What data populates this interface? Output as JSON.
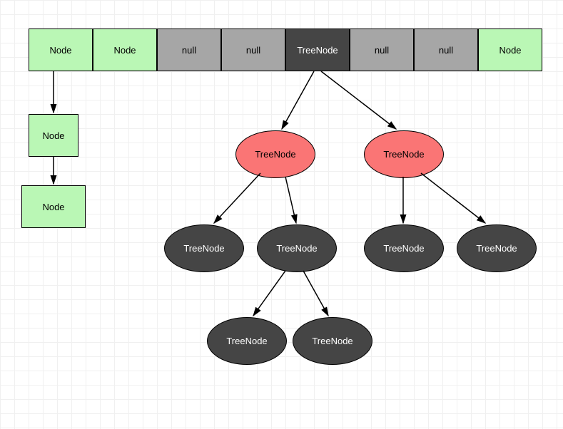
{
  "array": {
    "cells": [
      {
        "label": "Node",
        "type": "node"
      },
      {
        "label": "Node",
        "type": "node"
      },
      {
        "label": "null",
        "type": "null"
      },
      {
        "label": "null",
        "type": "null"
      },
      {
        "label": "TreeNode",
        "type": "tree-root"
      },
      {
        "label": "null",
        "type": "null"
      },
      {
        "label": "null",
        "type": "null"
      },
      {
        "label": "Node",
        "type": "node"
      }
    ]
  },
  "linkedList": {
    "n1": "Node",
    "n2": "Node"
  },
  "tree": {
    "left": {
      "root": "TreeNode",
      "leftChild": "TreeNode",
      "rightChild": "TreeNode",
      "grandLeft": "TreeNode",
      "grandRight": "TreeNode"
    },
    "right": {
      "root": "TreeNode",
      "leftChild": "TreeNode",
      "rightChild": "TreeNode"
    }
  },
  "colors": {
    "node": "#baf7b5",
    "null": "#a6a6a6",
    "treeRoot": "#454545",
    "treeRed": "#fa7575",
    "treeDark": "#454545"
  }
}
